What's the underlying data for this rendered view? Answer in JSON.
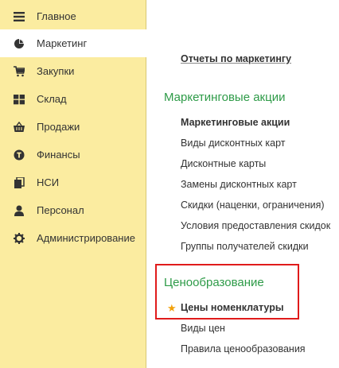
{
  "sidebar": {
    "items": [
      {
        "label": "Главное",
        "icon": "menu-lines-icon"
      },
      {
        "label": "Маркетинг",
        "icon": "pie-chart-icon"
      },
      {
        "label": "Закупки",
        "icon": "cart-icon"
      },
      {
        "label": "Склад",
        "icon": "grid-boxes-icon"
      },
      {
        "label": "Продажи",
        "icon": "basket-icon"
      },
      {
        "label": "Финансы",
        "icon": "coin-icon"
      },
      {
        "label": "НСИ",
        "icon": "documents-icon"
      },
      {
        "label": "Персонал",
        "icon": "person-icon"
      },
      {
        "label": "Администрирование",
        "icon": "gear-icon"
      }
    ],
    "active": "Маркетинг"
  },
  "content": {
    "reports_link": "Отчеты по маркетингу",
    "promo_section": {
      "title": "Маркетинговые акции",
      "links": [
        "Маркетинговые акции",
        "Виды дисконтных карт",
        "Дисконтные карты",
        "Замены дисконтных карт",
        "Скидки (наценки, ограничения)",
        "Условия предоставления скидок",
        "Группы получателей скидки"
      ]
    },
    "pricing_section": {
      "title": "Ценообразование",
      "links": [
        "Цены номенклатуры",
        "Виды цен",
        "Правила ценообразования"
      ],
      "favorite": "Цены номенклатуры"
    }
  },
  "colors": {
    "sidebar_bg": "#fbeca0",
    "section_title": "#2e9b48",
    "highlight_border": "#e01b1b",
    "star": "#f2a10c"
  }
}
